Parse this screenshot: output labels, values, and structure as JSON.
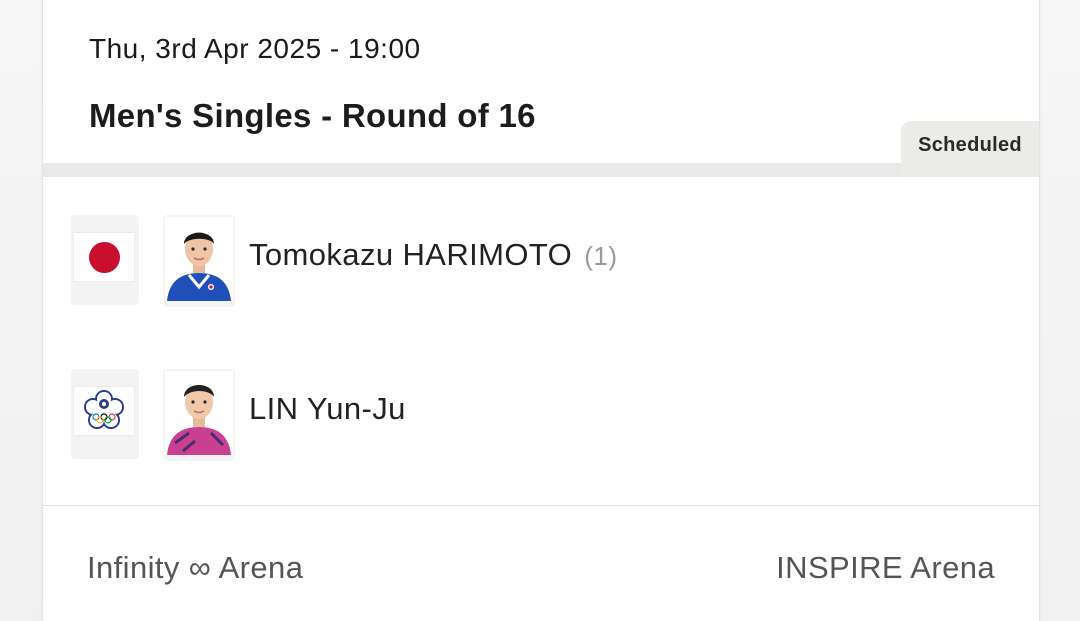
{
  "match": {
    "datetime": "Thu, 3rd Apr 2025 - 19:00",
    "title": "Men's Singles - Round of 16",
    "status": "Scheduled"
  },
  "players": [
    {
      "name": "Tomokazu HARIMOTO",
      "seed": "(1)",
      "flag_icon": "japan-flag-icon",
      "shirt_color": "#1f4fb8"
    },
    {
      "name": "LIN Yun-Ju",
      "seed": "",
      "flag_icon": "chinese-taipei-flag-icon",
      "shirt_color": "#c8408f"
    }
  ],
  "venue": {
    "name": "Infinity ∞ Arena",
    "arena": "INSPIRE Arena"
  },
  "colors": {
    "badge_bg": "#ebebe7",
    "japan_red": "#c8102e",
    "seed_gray": "#9a9a9a"
  }
}
